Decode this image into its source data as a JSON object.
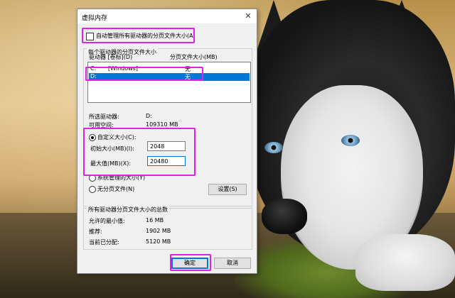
{
  "dialog": {
    "title": "虚拟内存",
    "close_icon": "close-icon"
  },
  "auto_manage": {
    "label": "自动管理所有驱动器的分页文件大小(A)",
    "checked": false
  },
  "per_drive_group": {
    "title": "每个驱动器的分页文件大小",
    "col_drive": "驱动器 [卷标](D)",
    "col_size": "分页文件大小(MB)",
    "drives": [
      {
        "letter": "C:",
        "label": "[Windows]",
        "size": "无",
        "selected": false
      },
      {
        "letter": "D:",
        "label": "",
        "size": "无",
        "selected": true
      }
    ],
    "selected_drive_label": "所选驱动器:",
    "selected_drive_value": "D:",
    "free_space_label": "可用空间:",
    "free_space_value": "109310 MB"
  },
  "size_options": {
    "custom_label": "自定义大小(C):",
    "custom_checked": true,
    "initial_label": "初始大小(MB)(I):",
    "initial_value": "2048",
    "max_label": "最大值(MB)(X):",
    "max_value": "20480",
    "system_label": "系统管理的大小(Y)",
    "none_label": "无分页文件(N)",
    "set_button": "设置(S)"
  },
  "totals_group": {
    "title": "所有驱动器分页文件大小的总数",
    "min_label": "允许的最小值:",
    "min_value": "16 MB",
    "recommended_label": "推荐:",
    "recommended_value": "1902 MB",
    "current_label": "当前已分配:",
    "current_value": "5120 MB"
  },
  "footer": {
    "ok_button": "确定",
    "cancel_button": "取消"
  },
  "highlight_color": "#e020e8"
}
